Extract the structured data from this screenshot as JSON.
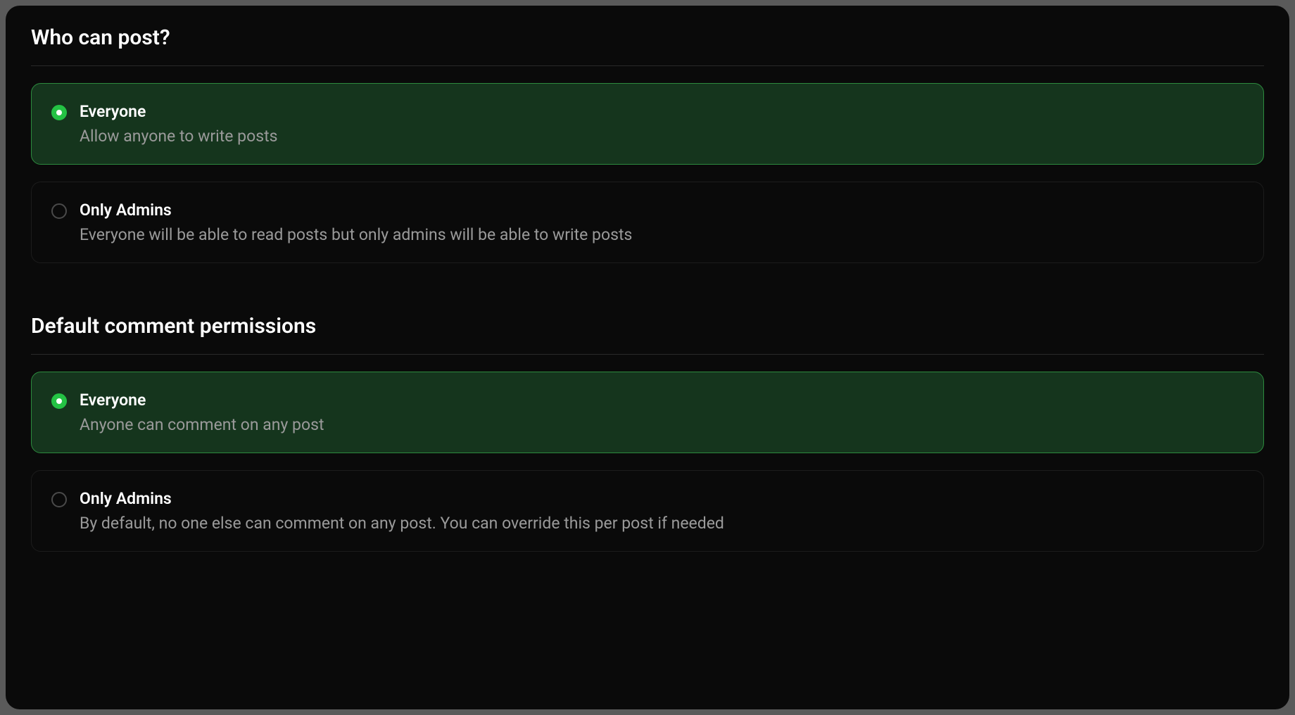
{
  "posting": {
    "title": "Who can post?",
    "options": [
      {
        "label": "Everyone",
        "desc": "Allow anyone to write posts",
        "selected": true
      },
      {
        "label": "Only Admins",
        "desc": "Everyone will be able to read posts but only admins will be able to write posts",
        "selected": false
      }
    ]
  },
  "comments": {
    "title": "Default comment permissions",
    "options": [
      {
        "label": "Everyone",
        "desc": "Anyone can comment on any post",
        "selected": true
      },
      {
        "label": "Only Admins",
        "desc": "By default, no one else can comment on any post. You can override this per post if needed",
        "selected": false
      }
    ]
  }
}
